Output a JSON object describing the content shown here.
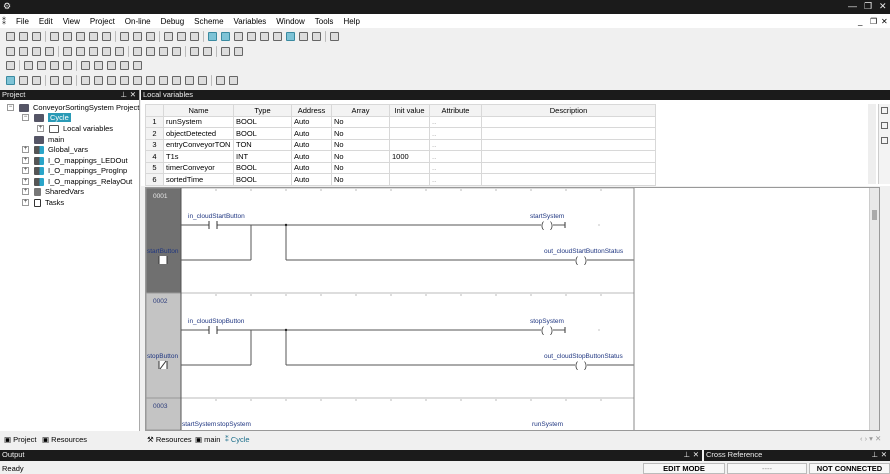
{
  "menu": [
    "File",
    "Edit",
    "View",
    "Project",
    "On-line",
    "Debug",
    "Scheme",
    "Variables",
    "Window",
    "Tools",
    "Help"
  ],
  "project_panel": {
    "title": "Project",
    "tree": [
      {
        "label": "ConveyorSortingSystem Project",
        "level": 0
      },
      {
        "label": "Cycle",
        "level": 1,
        "selected": true
      },
      {
        "label": "Local variables",
        "level": 2
      },
      {
        "label": "main",
        "level": 1
      },
      {
        "label": "Global_vars",
        "level": 1
      },
      {
        "label": "I_O_mappings_LEDOut",
        "level": 1
      },
      {
        "label": "I_O_mappings_ProgInp",
        "level": 1
      },
      {
        "label": "I_O_mappings_RelayOut",
        "level": 1
      },
      {
        "label": "SharedVars",
        "level": 1
      },
      {
        "label": "Tasks",
        "level": 1
      }
    ]
  },
  "local_vars": {
    "title": "Local variables",
    "columns": [
      "Name",
      "Type",
      "Address",
      "Array",
      "Init value",
      "Attribute",
      "Description"
    ],
    "rows": [
      [
        "1",
        "runSystem",
        "BOOL",
        "Auto",
        "No",
        "",
        "..",
        ""
      ],
      [
        "2",
        "objectDetected",
        "BOOL",
        "Auto",
        "No",
        "",
        "..",
        ""
      ],
      [
        "3",
        "entryConveyorTON",
        "TON",
        "Auto",
        "No",
        "",
        "..",
        ""
      ],
      [
        "4",
        "T1s",
        "INT",
        "Auto",
        "No",
        "1000",
        "..",
        ""
      ],
      [
        "5",
        "timerConveyor",
        "BOOL",
        "Auto",
        "No",
        "",
        "..",
        ""
      ],
      [
        "6",
        "sortedTime",
        "BOOL",
        "Auto",
        "No",
        "",
        "..",
        ""
      ]
    ]
  },
  "ladder": {
    "rungs": [
      {
        "num": "0001",
        "contacts": [
          "in_cloudStartButton",
          "startButton"
        ],
        "coils": [
          "startSystem",
          "out_cloudStartButtonStatus"
        ]
      },
      {
        "num": "0002",
        "contacts": [
          "in_cloudStopButton",
          "stopButton"
        ],
        "coils": [
          "stopSystem",
          "out_cloudStopButtonStatus"
        ]
      },
      {
        "num": "0003",
        "contacts": [
          "startSystem",
          "stopSystem"
        ],
        "coils": [
          "runSystem"
        ]
      }
    ]
  },
  "bottom_tabs_left": [
    "Project",
    "Resources"
  ],
  "bottom_tabs_editor": [
    "Resources",
    "main",
    "Cycle"
  ],
  "output": {
    "title": "Output"
  },
  "cross_reference": {
    "title": "Cross Reference"
  },
  "status": {
    "text": "Ready",
    "mode": "EDIT MODE",
    "middle": "----",
    "connection": "NOT CONNECTED"
  }
}
